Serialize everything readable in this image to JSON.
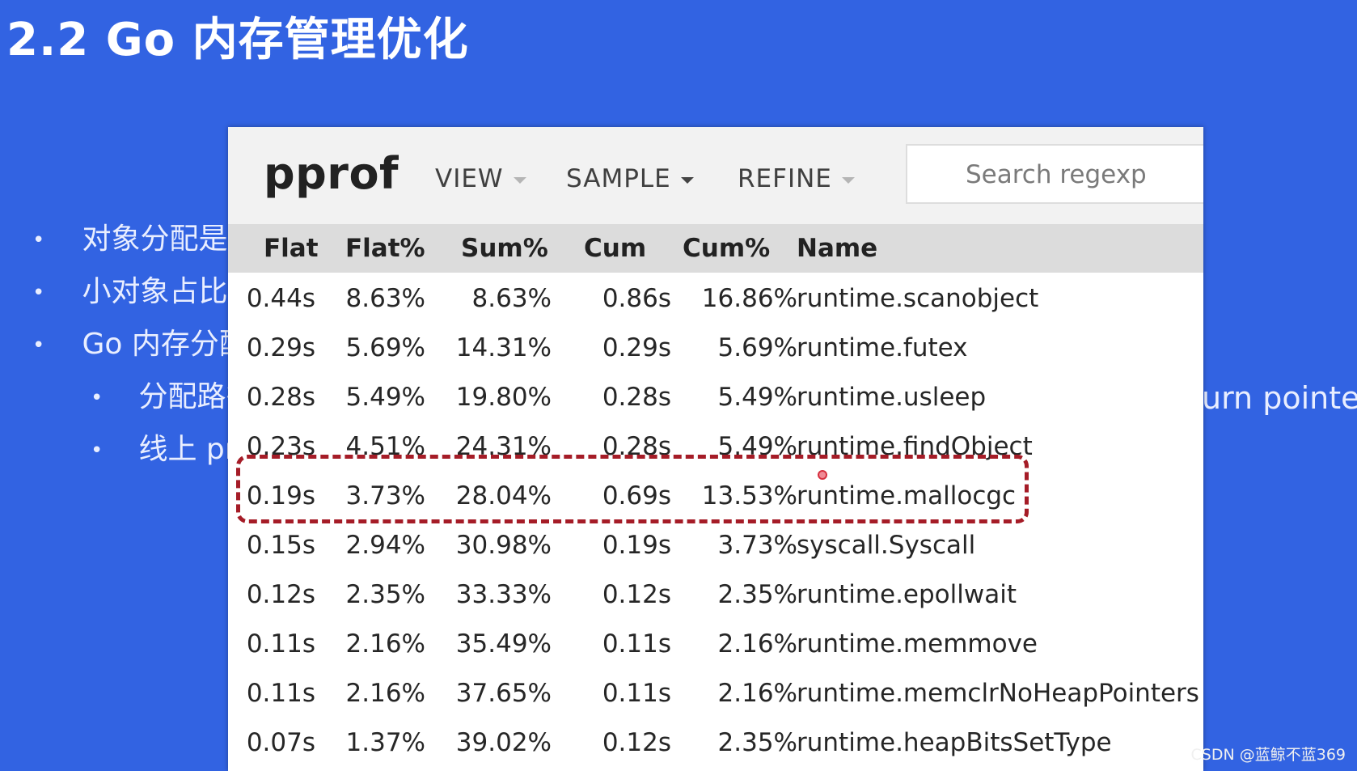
{
  "slide": {
    "title": "2.2 Go 内存管理优化",
    "bullets": [
      {
        "text": "对象分配是",
        "level": 1
      },
      {
        "text": "小对象占比",
        "level": 1
      },
      {
        "text": "Go 内存分配",
        "level": 1
      },
      {
        "text": "分配路径",
        "level": 2
      },
      {
        "text": "线上 pr",
        "level": 2
      }
    ],
    "right_fragment": "urn pointer"
  },
  "pprof": {
    "logo": "pprof",
    "menu": {
      "view": "VIEW",
      "sample": "SAMPLE",
      "refine": "REFINE"
    },
    "search_placeholder": "Search regexp",
    "columns": [
      "Flat",
      "Flat%",
      "Sum%",
      "Cum",
      "Cum%",
      "Name"
    ],
    "rows": [
      [
        "0.44s",
        "8.63%",
        "8.63%",
        "0.86s",
        "16.86%",
        "runtime.scanobject"
      ],
      [
        "0.29s",
        "5.69%",
        "14.31%",
        "0.29s",
        "5.69%",
        "runtime.futex"
      ],
      [
        "0.28s",
        "5.49%",
        "19.80%",
        "0.28s",
        "5.49%",
        "runtime.usleep"
      ],
      [
        "0.23s",
        "4.51%",
        "24.31%",
        "0.28s",
        "5.49%",
        "runtime.findObject"
      ],
      [
        "0.19s",
        "3.73%",
        "28.04%",
        "0.69s",
        "13.53%",
        "runtime.mallocgc"
      ],
      [
        "0.15s",
        "2.94%",
        "30.98%",
        "0.19s",
        "3.73%",
        "syscall.Syscall"
      ],
      [
        "0.12s",
        "2.35%",
        "33.33%",
        "0.12s",
        "2.35%",
        "runtime.epollwait"
      ],
      [
        "0.11s",
        "2.16%",
        "35.49%",
        "0.11s",
        "2.16%",
        "runtime.memmove"
      ],
      [
        "0.11s",
        "2.16%",
        "37.65%",
        "0.11s",
        "2.16%",
        "runtime.memclrNoHeapPointers"
      ],
      [
        "0.07s",
        "1.37%",
        "39.02%",
        "0.12s",
        "2.35%",
        "runtime.heapBitsSetType"
      ]
    ],
    "highlighted_row_name": "runtime.mallocgc"
  },
  "watermark": "CSDN @蓝鲸不蓝369",
  "colors": {
    "slide_background": "#3263e2",
    "highlight_border": "#a51c27",
    "table_header_bg": "#dcdcdc"
  }
}
